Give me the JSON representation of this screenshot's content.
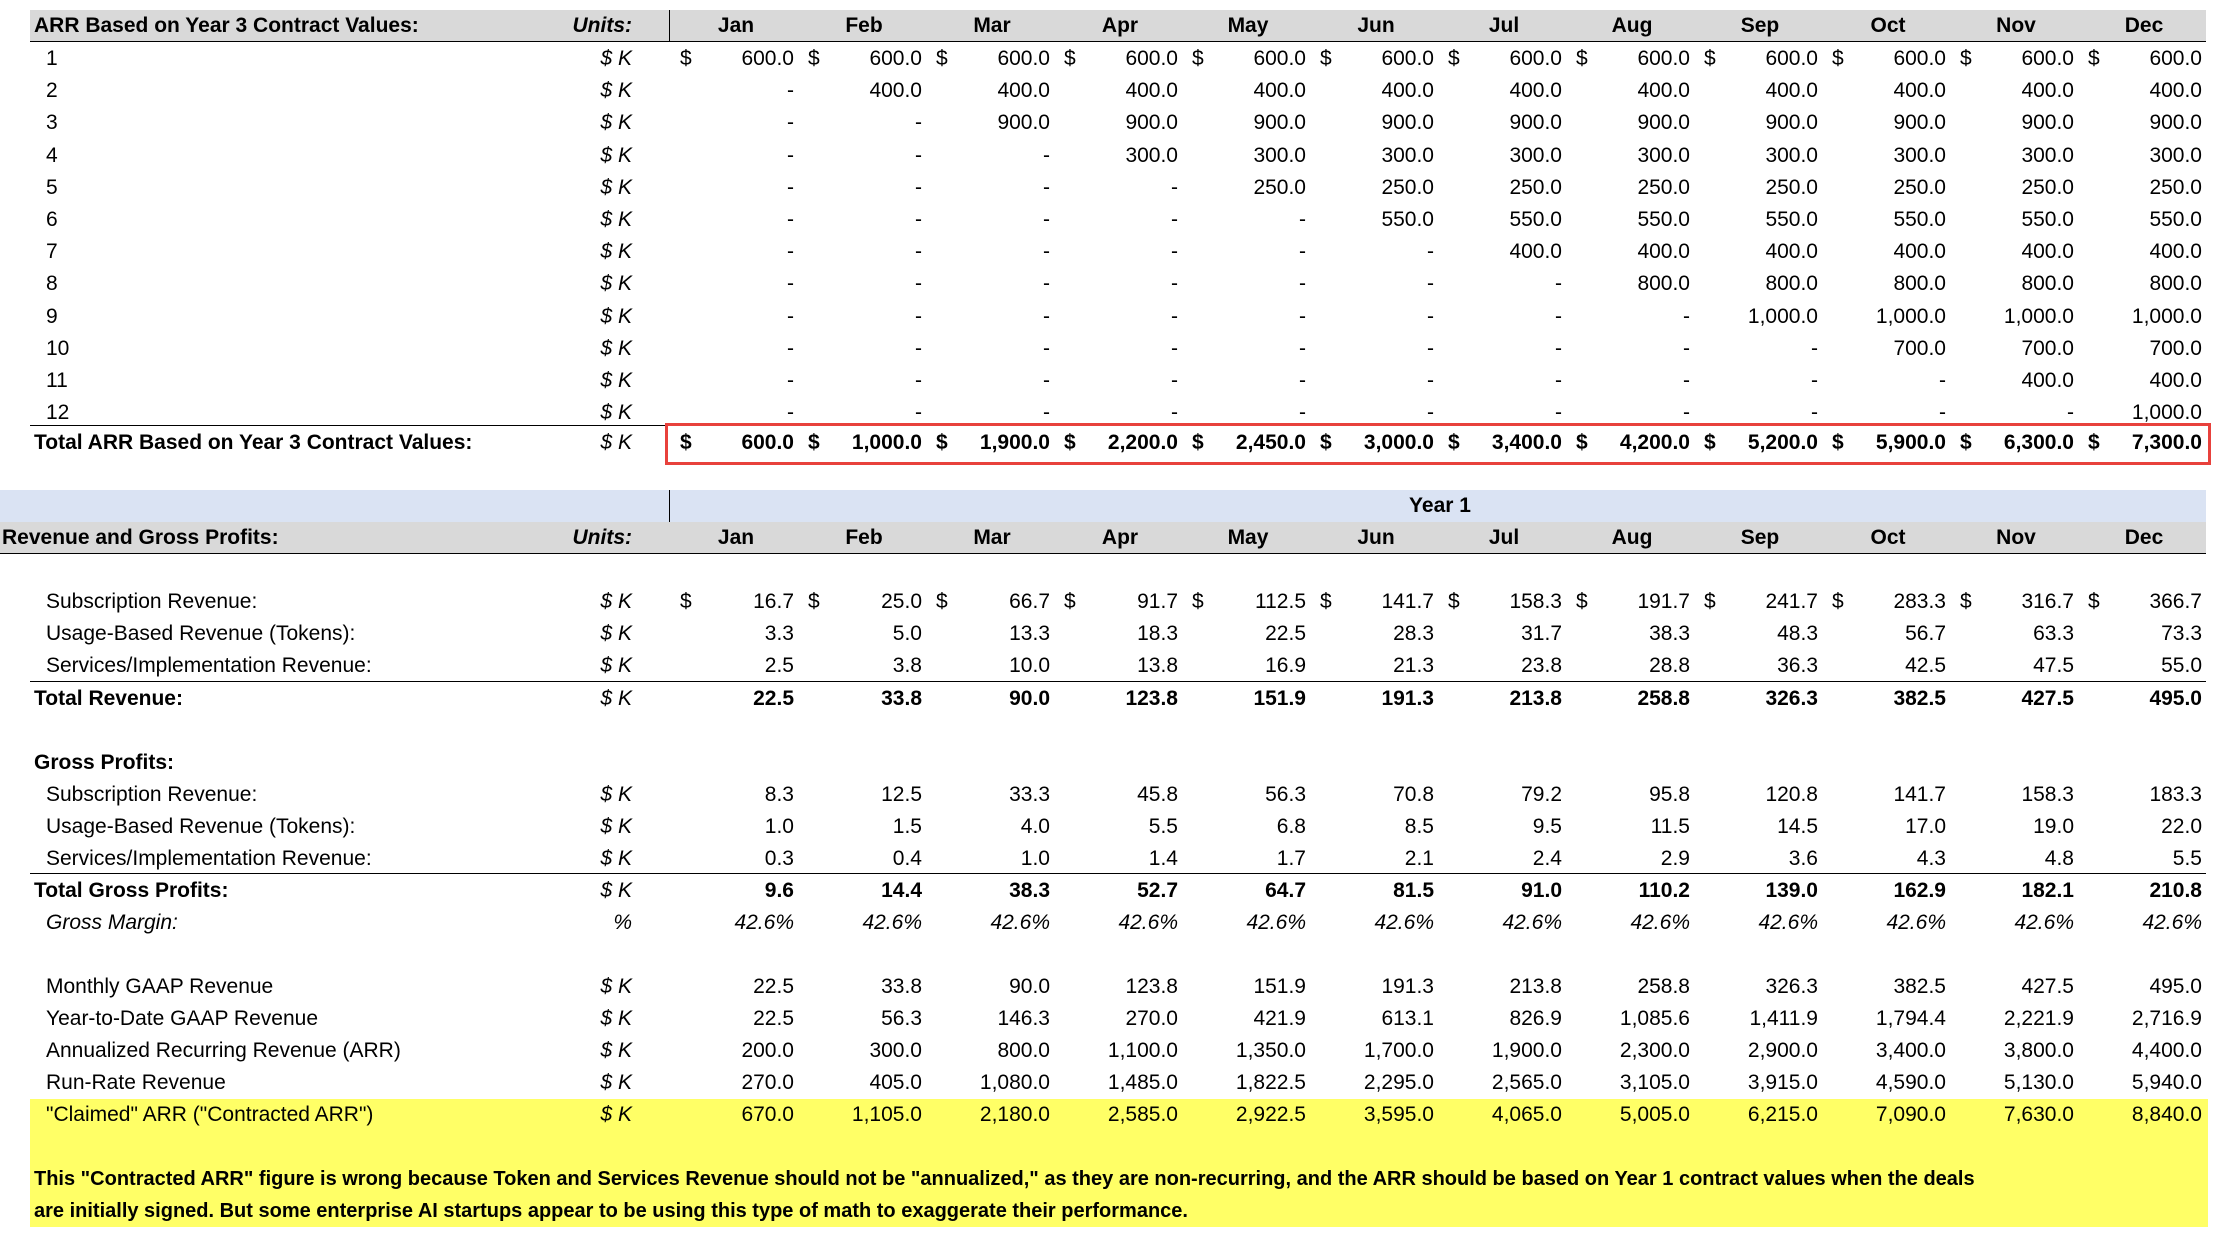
{
  "months": [
    "Jan",
    "Feb",
    "Mar",
    "Apr",
    "May",
    "Jun",
    "Jul",
    "Aug",
    "Sep",
    "Oct",
    "Nov",
    "Dec"
  ],
  "colors": {
    "header_gray": "#d9d9d9",
    "header_lavender": "#dae3f3",
    "highlight_yellow": "#ffff66",
    "box_red": "#e8413c"
  },
  "arr_table": {
    "title": "ARR Based on Year 3 Contract Values:",
    "units_header": "Units:",
    "rows": [
      {
        "label": "1",
        "unit": "$ K",
        "dollar": true,
        "values": [
          "600.0",
          "600.0",
          "600.0",
          "600.0",
          "600.0",
          "600.0",
          "600.0",
          "600.0",
          "600.0",
          "600.0",
          "600.0",
          "600.0"
        ]
      },
      {
        "label": "2",
        "unit": "$ K",
        "values": [
          "-",
          "400.0",
          "400.0",
          "400.0",
          "400.0",
          "400.0",
          "400.0",
          "400.0",
          "400.0",
          "400.0",
          "400.0",
          "400.0"
        ]
      },
      {
        "label": "3",
        "unit": "$ K",
        "values": [
          "-",
          "-",
          "900.0",
          "900.0",
          "900.0",
          "900.0",
          "900.0",
          "900.0",
          "900.0",
          "900.0",
          "900.0",
          "900.0"
        ]
      },
      {
        "label": "4",
        "unit": "$ K",
        "values": [
          "-",
          "-",
          "-",
          "300.0",
          "300.0",
          "300.0",
          "300.0",
          "300.0",
          "300.0",
          "300.0",
          "300.0",
          "300.0"
        ]
      },
      {
        "label": "5",
        "unit": "$ K",
        "values": [
          "-",
          "-",
          "-",
          "-",
          "250.0",
          "250.0",
          "250.0",
          "250.0",
          "250.0",
          "250.0",
          "250.0",
          "250.0"
        ]
      },
      {
        "label": "6",
        "unit": "$ K",
        "values": [
          "-",
          "-",
          "-",
          "-",
          "-",
          "550.0",
          "550.0",
          "550.0",
          "550.0",
          "550.0",
          "550.0",
          "550.0"
        ]
      },
      {
        "label": "7",
        "unit": "$ K",
        "values": [
          "-",
          "-",
          "-",
          "-",
          "-",
          "-",
          "400.0",
          "400.0",
          "400.0",
          "400.0",
          "400.0",
          "400.0"
        ]
      },
      {
        "label": "8",
        "unit": "$ K",
        "values": [
          "-",
          "-",
          "-",
          "-",
          "-",
          "-",
          "-",
          "800.0",
          "800.0",
          "800.0",
          "800.0",
          "800.0"
        ]
      },
      {
        "label": "9",
        "unit": "$ K",
        "values": [
          "-",
          "-",
          "-",
          "-",
          "-",
          "-",
          "-",
          "-",
          "1,000.0",
          "1,000.0",
          "1,000.0",
          "1,000.0"
        ]
      },
      {
        "label": "10",
        "unit": "$ K",
        "values": [
          "-",
          "-",
          "-",
          "-",
          "-",
          "-",
          "-",
          "-",
          "-",
          "700.0",
          "700.0",
          "700.0"
        ]
      },
      {
        "label": "11",
        "unit": "$ K",
        "values": [
          "-",
          "-",
          "-",
          "-",
          "-",
          "-",
          "-",
          "-",
          "-",
          "-",
          "400.0",
          "400.0"
        ]
      },
      {
        "label": "12",
        "unit": "$ K",
        "values": [
          "-",
          "-",
          "-",
          "-",
          "-",
          "-",
          "-",
          "-",
          "-",
          "-",
          "-",
          "1,000.0"
        ]
      }
    ],
    "total": {
      "label": "Total ARR Based on Year 3 Contract Values:",
      "unit": "$ K",
      "values": [
        "600.0",
        "1,000.0",
        "1,900.0",
        "2,200.0",
        "2,450.0",
        "3,000.0",
        "3,400.0",
        "4,200.0",
        "5,200.0",
        "5,900.0",
        "6,300.0",
        "7,300.0"
      ]
    }
  },
  "rev_table": {
    "year_label": "Year 1",
    "title": "Revenue and Gross Profits:",
    "units_header": "Units:",
    "revenue_rows": [
      {
        "label": "Subscription Revenue:",
        "unit": "$ K",
        "dollar": true,
        "values": [
          "16.7",
          "25.0",
          "66.7",
          "91.7",
          "112.5",
          "141.7",
          "158.3",
          "191.7",
          "241.7",
          "283.3",
          "316.7",
          "366.7"
        ]
      },
      {
        "label": "Usage-Based Revenue (Tokens):",
        "unit": "$ K",
        "values": [
          "3.3",
          "5.0",
          "13.3",
          "18.3",
          "22.5",
          "28.3",
          "31.7",
          "38.3",
          "48.3",
          "56.7",
          "63.3",
          "73.3"
        ]
      },
      {
        "label": "Services/Implementation Revenue:",
        "unit": "$ K",
        "values": [
          "2.5",
          "3.8",
          "10.0",
          "13.8",
          "16.9",
          "21.3",
          "23.8",
          "28.8",
          "36.3",
          "42.5",
          "47.5",
          "55.0"
        ]
      }
    ],
    "total_revenue": {
      "label": "Total Revenue:",
      "unit": "$ K",
      "values": [
        "22.5",
        "33.8",
        "90.0",
        "123.8",
        "151.9",
        "191.3",
        "213.8",
        "258.8",
        "326.3",
        "382.5",
        "427.5",
        "495.0"
      ]
    },
    "gp_heading": "Gross Profits:",
    "gp_rows": [
      {
        "label": "Subscription Revenue:",
        "unit": "$ K",
        "values": [
          "8.3",
          "12.5",
          "33.3",
          "45.8",
          "56.3",
          "70.8",
          "79.2",
          "95.8",
          "120.8",
          "141.7",
          "158.3",
          "183.3"
        ]
      },
      {
        "label": "Usage-Based Revenue (Tokens):",
        "unit": "$ K",
        "values": [
          "1.0",
          "1.5",
          "4.0",
          "5.5",
          "6.8",
          "8.5",
          "9.5",
          "11.5",
          "14.5",
          "17.0",
          "19.0",
          "22.0"
        ]
      },
      {
        "label": "Services/Implementation Revenue:",
        "unit": "$ K",
        "values": [
          "0.3",
          "0.4",
          "1.0",
          "1.4",
          "1.7",
          "2.1",
          "2.4",
          "2.9",
          "3.6",
          "4.3",
          "4.8",
          "5.5"
        ]
      }
    ],
    "total_gp": {
      "label": "Total Gross Profits:",
      "unit": "$ K",
      "values": [
        "9.6",
        "14.4",
        "38.3",
        "52.7",
        "64.7",
        "81.5",
        "91.0",
        "110.2",
        "139.0",
        "162.9",
        "182.1",
        "210.8"
      ]
    },
    "gross_margin": {
      "label": "Gross Margin:",
      "unit": "%",
      "values": [
        "42.6%",
        "42.6%",
        "42.6%",
        "42.6%",
        "42.6%",
        "42.6%",
        "42.6%",
        "42.6%",
        "42.6%",
        "42.6%",
        "42.6%",
        "42.6%"
      ]
    },
    "metric_rows": [
      {
        "label": "Monthly GAAP Revenue",
        "unit": "$ K",
        "values": [
          "22.5",
          "33.8",
          "90.0",
          "123.8",
          "151.9",
          "191.3",
          "213.8",
          "258.8",
          "326.3",
          "382.5",
          "427.5",
          "495.0"
        ]
      },
      {
        "label": "Year-to-Date GAAP Revenue",
        "unit": "$ K",
        "values": [
          "22.5",
          "56.3",
          "146.3",
          "270.0",
          "421.9",
          "613.1",
          "826.9",
          "1,085.6",
          "1,411.9",
          "1,794.4",
          "2,221.9",
          "2,716.9"
        ]
      },
      {
        "label": "Annualized Recurring Revenue (ARR)",
        "unit": "$ K",
        "values": [
          "200.0",
          "300.0",
          "800.0",
          "1,100.0",
          "1,350.0",
          "1,700.0",
          "1,900.0",
          "2,300.0",
          "2,900.0",
          "3,400.0",
          "3,800.0",
          "4,400.0"
        ]
      },
      {
        "label": "Run-Rate Revenue",
        "unit": "$ K",
        "values": [
          "270.0",
          "405.0",
          "1,080.0",
          "1,485.0",
          "1,822.5",
          "2,295.0",
          "2,565.0",
          "3,105.0",
          "3,915.0",
          "4,590.0",
          "5,130.0",
          "5,940.0"
        ]
      }
    ],
    "claimed": {
      "label": "\"Claimed\" ARR (\"Contracted ARR\")",
      "unit": "$ K",
      "values": [
        "670.0",
        "1,105.0",
        "2,180.0",
        "2,585.0",
        "2,922.5",
        "3,595.0",
        "4,065.0",
        "5,005.0",
        "6,215.0",
        "7,090.0",
        "7,630.0",
        "8,840.0"
      ]
    },
    "note_line1": "This \"Contracted ARR\" figure is wrong because Token and Services Revenue should not be \"annualized,\" as they are non-recurring, and the ARR should be based on Year 1 contract values when the deals",
    "note_line2": "are initially signed. But some enterprise AI startups appear to be using this type of math to exaggerate their performance.",
    "dollar_sign": "$"
  }
}
